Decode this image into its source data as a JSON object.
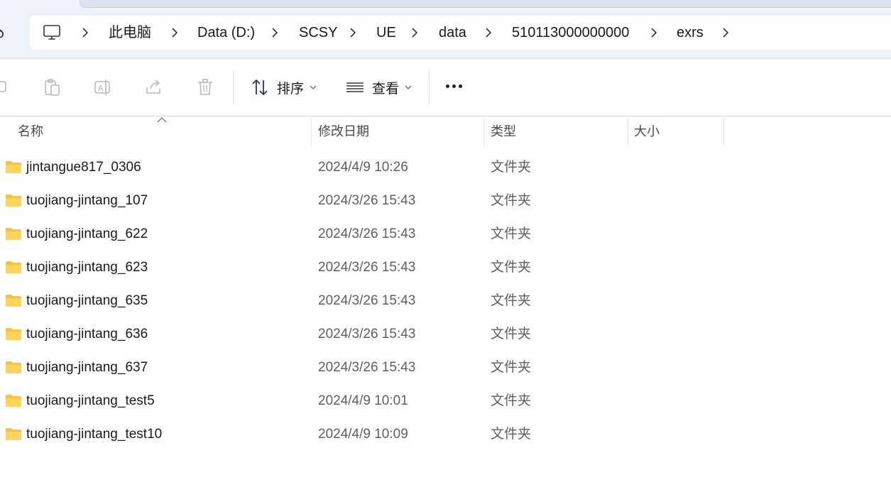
{
  "address": {
    "back_glyph": "ꝺ",
    "segments": [
      {
        "label": "此电脑"
      },
      {
        "label": "Data (D:)"
      },
      {
        "label": "SCSY"
      },
      {
        "label": "UE"
      },
      {
        "label": "data"
      },
      {
        "label": "510113000000000"
      },
      {
        "label": "exrs"
      }
    ]
  },
  "toolbar": {
    "sort_label": "排序",
    "view_label": "查看"
  },
  "columns": {
    "name": "名称",
    "modified": "修改日期",
    "type": "类型",
    "size": "大小"
  },
  "files": [
    {
      "name": "jintangue817_0306",
      "modified": "2024/4/9 10:26",
      "type": "文件夹"
    },
    {
      "name": "tuojiang-jintang_107",
      "modified": "2024/3/26 15:43",
      "type": "文件夹"
    },
    {
      "name": "tuojiang-jintang_622",
      "modified": "2024/3/26 15:43",
      "type": "文件夹"
    },
    {
      "name": "tuojiang-jintang_623",
      "modified": "2024/3/26 15:43",
      "type": "文件夹"
    },
    {
      "name": "tuojiang-jintang_635",
      "modified": "2024/3/26 15:43",
      "type": "文件夹"
    },
    {
      "name": "tuojiang-jintang_636",
      "modified": "2024/3/26 15:43",
      "type": "文件夹"
    },
    {
      "name": "tuojiang-jintang_637",
      "modified": "2024/3/26 15:43",
      "type": "文件夹"
    },
    {
      "name": "tuojiang-jintang_test5",
      "modified": "2024/4/9 10:01",
      "type": "文件夹"
    },
    {
      "name": "tuojiang-jintang_test10",
      "modified": "2024/4/9 10:09",
      "type": "文件夹"
    }
  ],
  "icons": {
    "computer": "computer-icon",
    "chevron": "chevron-right-icon",
    "folder": "folder-icon",
    "folder_color": "#f7c948"
  }
}
